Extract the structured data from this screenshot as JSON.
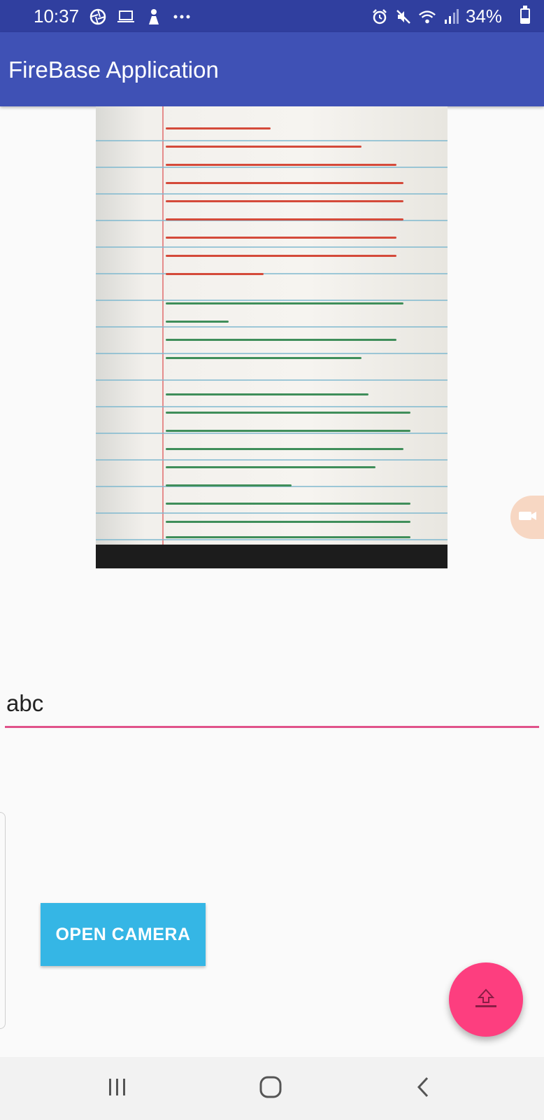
{
  "status_bar": {
    "time": "10:37",
    "battery": "34%",
    "left_icons": [
      "aperture-icon",
      "laptop-icon",
      "person-icon",
      "more-icon"
    ],
    "right_icons": [
      "alarm-icon",
      "mute-icon",
      "wifi-icon",
      "signal-icon",
      "battery-icon"
    ]
  },
  "app_bar": {
    "title": "FireBase Application"
  },
  "input": {
    "value": "abc"
  },
  "buttons": {
    "open_camera": "OPEN CAMERA"
  },
  "colors": {
    "status_bar": "#303f9f",
    "app_bar": "#3f51b5",
    "input_underline": "#e0528a",
    "camera_button": "#35b6e5",
    "fab": "#fd3e7f"
  },
  "nav_bar": {
    "items": [
      "recents-icon",
      "home-icon",
      "back-icon"
    ]
  }
}
